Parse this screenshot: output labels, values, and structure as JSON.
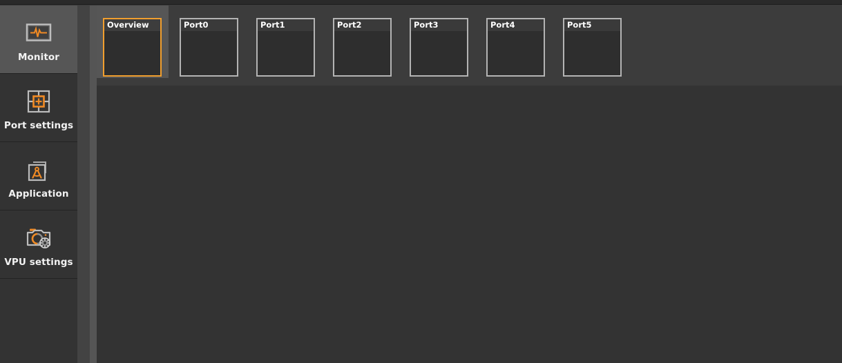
{
  "colors": {
    "accent": "#f29f2e",
    "window_bg": "#3c3c3c",
    "sidebar_bg": "#333333",
    "sidebar_selected_bg": "#565656",
    "tab_border": "#b4b4b4",
    "tab_bg": "#2e2e2e",
    "content_bg": "#333333",
    "topbar_bg": "#2a2a2a",
    "text": "#f2f2f2"
  },
  "sidebar": {
    "items": [
      {
        "label": "Monitor",
        "icon": "monitor-waveform-icon",
        "selected": true
      },
      {
        "label": "Port settings",
        "icon": "port-crosshair-icon",
        "selected": false
      },
      {
        "label": "Application",
        "icon": "application-compass-icon",
        "selected": false
      },
      {
        "label": "VPU settings",
        "icon": "camera-gear-icon",
        "selected": false
      }
    ]
  },
  "tabstrip": {
    "tabs": [
      {
        "label": "Overview",
        "selected": true
      },
      {
        "label": "Port0",
        "selected": false
      },
      {
        "label": "Port1",
        "selected": false
      },
      {
        "label": "Port2",
        "selected": false
      },
      {
        "label": "Port3",
        "selected": false
      },
      {
        "label": "Port4",
        "selected": false
      },
      {
        "label": "Port5",
        "selected": false
      }
    ]
  },
  "content": {
    "empty": ""
  }
}
